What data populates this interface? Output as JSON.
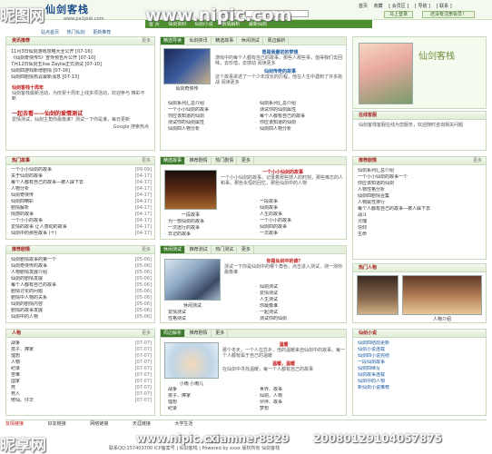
{
  "watermark": {
    "top_left": "昵图网",
    "top_url": "www.nipic.com",
    "bottom_left": "昵享网",
    "bottom_url": "www.nipic.cn",
    "bottom_author": "xiamner8329",
    "bottom_date": "20080129104057875"
  },
  "logo": {
    "title": "仙剑客栈",
    "subtitle": "www.pa1pub.com"
  },
  "search": {
    "select": "标题",
    "button": "搜索"
  },
  "toplinks": [
    "首页",
    "收藏",
    "[ 会员区 ]",
    "[ 导航 ]",
    "[ 联系 ]"
  ],
  "topbuttons": {
    "login": "马上登录",
    "reg": "还没有注册会员！"
  },
  "nav": [
    "首 页",
    "仙剑资料",
    "仙剑小说",
    "剧情解析",
    "最新仙剑"
  ],
  "subnav": [
    "站点首页",
    "热门仙剑",
    "更新推荐"
  ],
  "box_news": {
    "title": "资讯推荐",
    "more": "更多",
    "items": [
      {
        "t": "11月3日仙剑游戏攻略大全公开 [07-16]"
      },
      {
        "t": "《仙剑奇侠传5》宣传预告片公开 [07-10]"
      },
      {
        "t": "7月12日仙剑五lisa Zaylia正式测试 [07-10]"
      },
      {
        "t": "仙剑四游戏新增剧情 [07-16]"
      },
      {
        "t": "仙剑四剧情热议最新消息 [07-13]"
      }
    ],
    "headline": "仙剑客栈十周年",
    "text": "仙剑客栈最新活动，为庆祝十周年上线多项活动，欢迎参与 精彩不断",
    "headline2": "一起去看——仙剑的爱情测试",
    "text2": "爱情测试，仙剑主角你最像谁？测试一下你是谁，每日更新",
    "adtext": "Google 搜索热点"
  },
  "box_guide": {
    "title": "精选导读",
    "tabs": [
      "仙剑资讯",
      "精选故事",
      "休闲测试",
      "周边解析"
    ],
    "feature_title": "曾是我最初的梦想",
    "feature_text": "游戏中的每个人都有自己的故事，那些人那些事，值得我们去回味，去珍惜，去感动 阅读更多",
    "feature_title2": "仙剑传奇的故事",
    "feature_text2": "这个故事讲述了一个少年成长的历程，他在人生中遇到了许多挑战 阅读更多",
    "caption": "仙剑奇侠传",
    "items_left": [
      {
        "t": "仙剑系列汇总介绍"
      },
      {
        "t": "一个小小仙剑的故事"
      },
      {
        "t": "你应该知道的仙剑"
      },
      {
        "t": "测试你的仙剑属性"
      },
      {
        "t": "仙剑四人物分析"
      }
    ],
    "items_right": [
      {
        "t": "仙剑系列汇总介绍"
      },
      {
        "t": "测试你的仙剑属性"
      },
      {
        "t": "每个人都有自己的故事"
      },
      {
        "t": "你应该知道的仙剑"
      },
      {
        "t": "仙剑四人物分析"
      }
    ]
  },
  "box_right_top": {
    "title": "在线客服",
    "caption": "仙剑客栈",
    "text": "仙剑客栈客服在线为您服务，欢迎随时咨询相关问题"
  },
  "box_recommend": {
    "title": "推荐剧情",
    "more": "更多",
    "items": [
      {
        "t": "仙剑系列汇总介绍"
      },
      {
        "t": "一个小小仙剑的故事一个"
      },
      {
        "t": "你应该知道的仙剑"
      },
      {
        "t": "人物性格分析"
      },
      {
        "t": "仙剑四剧情合集"
      },
      {
        "t": "人物属性排行"
      },
      {
        "t": "每个人都有自己的故事—被人踩下去"
      },
      {
        "t": "战斗"
      },
      {
        "t": "灵魂"
      },
      {
        "t": "信仰"
      },
      {
        "t": "生命"
      }
    ]
  },
  "box_left2": {
    "title": "热门故事",
    "more": "更多",
    "items": [
      {
        "t": "一个小小仙剑的故事",
        "d": "[09-09]"
      },
      {
        "t": "关于仙剑的故事",
        "d": "[04-17]"
      },
      {
        "t": "每个人都有自己的故事—被人踩下去",
        "d": "[04-17]"
      },
      {
        "t": "人物分析",
        "d": "[04-17]"
      },
      {
        "t": "仙剑奇侠传",
        "d": "[04-17]"
      },
      {
        "t": "仙剑四精彩",
        "d": "[04-17]"
      },
      {
        "t": "剧情解析",
        "d": "[04-17]"
      },
      {
        "t": "情感的故事",
        "d": "[04-17]"
      },
      {
        "t": "一个小小的故事",
        "d": "[04-17]"
      },
      {
        "t": "爱情的故事 让人感动的故事",
        "d": "[04-17]"
      },
      {
        "t": "仙剑中的那些故事 (十)",
        "d": "[04-17]"
      }
    ]
  },
  "box_mid2": {
    "title": "精选故事",
    "tabs": [
      "推荐剧情",
      "热门剧情",
      "更多"
    ],
    "feature_title": "一个小小仙剑的故事",
    "feature_text": "一个小小仙剑的故事，记录着那些感人的时刻，那些难忘的人和事，那些永恒的回忆，那些仙剑中的人物",
    "caption": "一段故事",
    "items_left": [
      {
        "t": "为一部仙剑的故事"
      },
      {
        "t": "一次远行的故事"
      },
      {
        "t": "日记的故事"
      },
      {
        "t": "仙剑的故事"
      },
      {
        "t": "一个小小仙剑的故事"
      },
      {
        "t": "一次故事一生"
      }
    ],
    "items_right": [
      {
        "t": "一段故事"
      },
      {
        "t": "仙剑故事"
      },
      {
        "t": "人生的故事"
      },
      {
        "t": "一个小小的故事"
      },
      {
        "t": "仙剑四的故事"
      },
      {
        "t": "一次故事"
      }
    ]
  },
  "box_right2": {
    "title": "热门人物",
    "caption": "人物介绍"
  },
  "box_left3": {
    "title": "推荐剧情",
    "more": "更多",
    "items": [
      {
        "t": "仙剑剧情故事的第一个",
        "d": "[05-06]"
      },
      {
        "t": "仙剑奇侠传的故事",
        "d": "[05-06]"
      },
      {
        "t": "人物剧情发展介绍",
        "d": "[05-06]"
      },
      {
        "t": "仙剑的剧情发展",
        "d": "[05-06]"
      },
      {
        "t": "每个人都有自己的故事",
        "d": "[05-06]"
      },
      {
        "t": "剧情讨论的问题",
        "d": "[05-06]"
      },
      {
        "t": "剧情中人物的关系",
        "d": "[05-06]"
      },
      {
        "t": "仙剑的剧情内容",
        "d": "[05-06]"
      },
      {
        "t": "剧情的故事发展",
        "d": "[05-06]"
      },
      {
        "t": "仙剑中的人物",
        "d": "[05-06]"
      }
    ]
  },
  "box_mid3": {
    "title": "休闲测试",
    "tabs": [
      "推荐测试",
      "热门测试",
      "更多"
    ],
    "feature_title": "你是仙剑中的谁？",
    "feature_text": "测试一下你是仙剑中的哪个角色，点击进入测试，测一测你最像谁",
    "caption": "休闲测试",
    "items_left": [
      {
        "t": "爱情测试"
      },
      {
        "t": "性格测试"
      },
      {
        "t": "你的仙剑属性"
      },
      {
        "t": "你的未来"
      },
      {
        "t": "仙剑测试"
      },
      {
        "t": "你是谁"
      }
    ],
    "items_right": [
      {
        "t": "仙剑测试"
      },
      {
        "t": "爱情测试"
      },
      {
        "t": "人生测试"
      },
      {
        "t": "你最像谁"
      },
      {
        "t": "一起测试"
      },
      {
        "t": "测试你的仙剑"
      }
    ]
  },
  "box_right3": {
    "title": "仙剑小说",
    "items": [
      {
        "t": "仙剑四结局更新"
      },
      {
        "t": "仙剑小说连载"
      },
      {
        "t": "仙剑四小说完结"
      },
      {
        "t": "一段仙剑故事"
      },
      {
        "t": "仙剑四续写"
      },
      {
        "t": "仙剑故事连载"
      },
      {
        "t": "仙剑中的人物"
      },
      {
        "t": "新仙剑小说推荐"
      }
    ]
  },
  "box_left4": {
    "title": "人物",
    "more": "更多",
    "items": [
      {
        "t": "战争",
        "d": "[07-07]"
      },
      {
        "t": "孩子、捧家",
        "d": "[07-07]"
      },
      {
        "t": "理想",
        "d": "[07-07]"
      },
      {
        "t": "人物",
        "d": "[07-07]"
      },
      {
        "t": "纪录",
        "d": "[07-07]"
      },
      {
        "t": "苦难",
        "d": "[07-07]"
      },
      {
        "t": "国家",
        "d": "[07-07]"
      },
      {
        "t": "死",
        "d": "[07-07]"
      },
      {
        "t": "死人",
        "d": "[07-07]"
      },
      {
        "t": "修仙、仔华",
        "d": "[07-07]"
      }
    ]
  },
  "box_mid4": {
    "title": "周边解析",
    "tabs": [
      "推荐剧情",
      "更多"
    ],
    "caption": "小雨 小雨儿",
    "feature_title": "温暖",
    "feature_text": "那个冬天，一个人在异乡，他的温暖来自仙剑中的故事，每一个人都有属于自己的温暖",
    "feature_title2": "温暖，温暖",
    "feature_text2": "在仙剑中寻找温暖，每一个人都有自己的故事",
    "items_left": [
      {
        "t": "战争"
      },
      {
        "t": "孩子、捧家"
      },
      {
        "t": "理想"
      },
      {
        "t": "纪录"
      },
      {
        "t": "国家"
      }
    ],
    "items_right": [
      {
        "t": "世界、故事"
      },
      {
        "t": "仙剑、人物"
      },
      {
        "t": "伙伴、故事"
      },
      {
        "t": "梦想"
      },
      {
        "t": "信仰"
      }
    ]
  },
  "friend_links": {
    "label": "友情链接",
    "items": [
      "好友链接",
      "网络链接",
      "天涯链接",
      "大学生活"
    ]
  },
  "footer": "联系QQ:157403700 ICP备案号 | 仙剑客栈 | Powered by xxxx 版权所有 仙剑客栈"
}
